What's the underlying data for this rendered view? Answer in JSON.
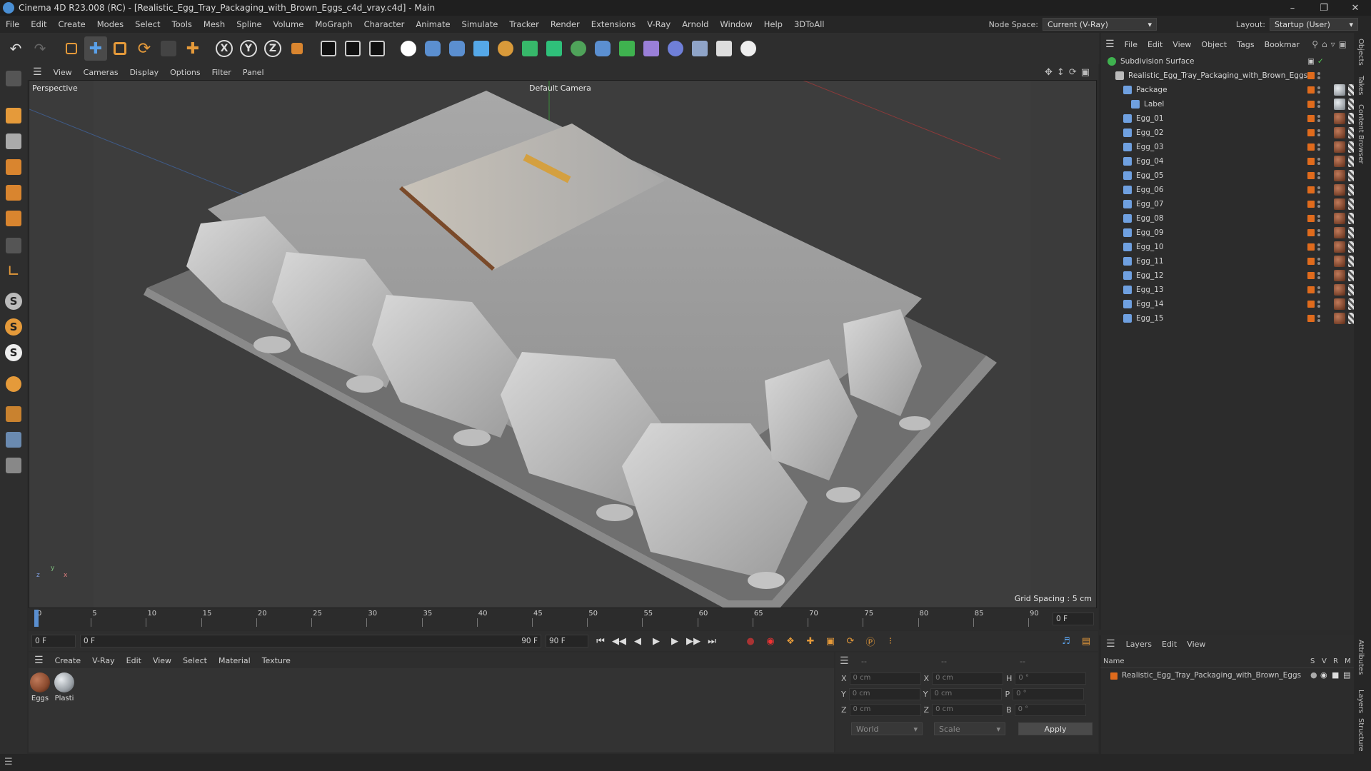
{
  "window": {
    "title": "Cinema 4D R23.008 (RC) - [Realistic_Egg_Tray_Packaging_with_Brown_Eggs_c4d_vray.c4d] - Main"
  },
  "menubar": [
    "File",
    "Edit",
    "Create",
    "Modes",
    "Select",
    "Tools",
    "Mesh",
    "Spline",
    "Volume",
    "MoGraph",
    "Character",
    "Animate",
    "Simulate",
    "Tracker",
    "Render",
    "Extensions",
    "V-Ray",
    "Arnold",
    "Window",
    "Help",
    "3DToAll"
  ],
  "node_space": {
    "label": "Node Space:",
    "value": "Current (V-Ray)"
  },
  "layout": {
    "label": "Layout:",
    "value": "Startup (User)"
  },
  "toolbar_axes": [
    "X",
    "Y",
    "Z"
  ],
  "viewport_menu": [
    "View",
    "Cameras",
    "Display",
    "Options",
    "Filter",
    "Panel"
  ],
  "viewport": {
    "view_name": "Perspective",
    "camera": "Default Camera",
    "grid_spacing": "Grid Spacing : 5 cm",
    "axis_labels": {
      "y": "y",
      "z": "z",
      "x": "x"
    }
  },
  "timeline": {
    "ticks": [
      "0",
      "5",
      "10",
      "15",
      "20",
      "25",
      "30",
      "35",
      "40",
      "45",
      "50",
      "55",
      "60",
      "65",
      "70",
      "75",
      "80",
      "85",
      "90"
    ],
    "end_field": "0 F"
  },
  "playbar": {
    "current": "0 F",
    "range_start": "0 F",
    "range_end": "90 F",
    "max": "90 F"
  },
  "material_menu": [
    "Create",
    "V-Ray",
    "Edit",
    "View",
    "Select",
    "Material",
    "Texture"
  ],
  "materials": [
    {
      "name": "Eggs",
      "color": "#8a4a2e"
    },
    {
      "name": "Plasti",
      "color": "#9aa0a6"
    }
  ],
  "coords": {
    "header1": "--",
    "header2": "--",
    "header3": "--",
    "rows": [
      {
        "a": "X",
        "av": "0 cm",
        "b": "X",
        "bv": "0 cm",
        "c": "H",
        "cv": "0 °"
      },
      {
        "a": "Y",
        "av": "0 cm",
        "b": "Y",
        "bv": "0 cm",
        "c": "P",
        "cv": "0 °"
      },
      {
        "a": "Z",
        "av": "0 cm",
        "b": "Z",
        "bv": "0 cm",
        "c": "B",
        "cv": "0 °"
      }
    ],
    "mode": "World",
    "scale": "Scale",
    "apply": "Apply"
  },
  "object_menu": [
    "File",
    "Edit",
    "View",
    "Object",
    "Tags",
    "Bookmar"
  ],
  "objects": [
    {
      "name": "Subdivision Surface",
      "level": 0
    },
    {
      "name": "Realistic_Egg_Tray_Packaging_with_Brown_Eggs",
      "level": 1
    },
    {
      "name": "Package",
      "level": 2
    },
    {
      "name": "Label",
      "level": 3
    },
    {
      "name": "Egg_01",
      "level": 2
    },
    {
      "name": "Egg_02",
      "level": 2
    },
    {
      "name": "Egg_03",
      "level": 2
    },
    {
      "name": "Egg_04",
      "level": 2
    },
    {
      "name": "Egg_05",
      "level": 2
    },
    {
      "name": "Egg_06",
      "level": 2
    },
    {
      "name": "Egg_07",
      "level": 2
    },
    {
      "name": "Egg_08",
      "level": 2
    },
    {
      "name": "Egg_09",
      "level": 2
    },
    {
      "name": "Egg_10",
      "level": 2
    },
    {
      "name": "Egg_11",
      "level": 2
    },
    {
      "name": "Egg_12",
      "level": 2
    },
    {
      "name": "Egg_13",
      "level": 2
    },
    {
      "name": "Egg_14",
      "level": 2
    },
    {
      "name": "Egg_15",
      "level": 2
    }
  ],
  "layers_menu": [
    "Layers",
    "Edit",
    "View"
  ],
  "layers": {
    "columns": {
      "name": "Name",
      "s": "S",
      "v": "V",
      "r": "R",
      "m": "M"
    },
    "rows": [
      {
        "name": "Realistic_Egg_Tray_Packaging_with_Brown_Eggs"
      }
    ]
  },
  "right_tabs": [
    "Objects",
    "Takes",
    "Content Browser",
    "Attributes",
    "Layers",
    "Structure"
  ],
  "colors": {
    "accent_orange": "#e06b1c",
    "accent_blue": "#4a8fd4",
    "egg_brown": "#8a4a2e"
  }
}
